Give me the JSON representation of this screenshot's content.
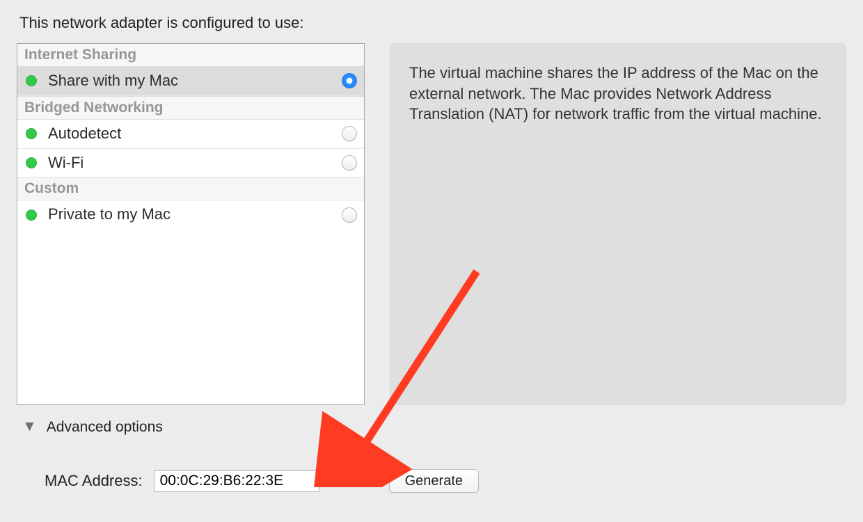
{
  "heading": "This network adapter is configured to use:",
  "sections": {
    "internet_sharing": {
      "header": "Internet Sharing",
      "items": {
        "share_with_mac": "Share with my Mac"
      }
    },
    "bridged": {
      "header": "Bridged Networking",
      "items": {
        "autodetect": "Autodetect",
        "wifi": "Wi-Fi"
      }
    },
    "custom": {
      "header": "Custom",
      "items": {
        "private_to_mac": "Private to my Mac"
      }
    }
  },
  "description": "The virtual machine shares the IP address of the Mac on the external network. The Mac provides Network Address Translation (NAT) for network traffic from the virtual machine.",
  "advanced_label": "Advanced options",
  "mac": {
    "label": "MAC Address:",
    "value": "00:0C:29:B6:22:3E",
    "generate_label": "Generate"
  },
  "annotation": {
    "arrow_color": "#ff3b22"
  }
}
